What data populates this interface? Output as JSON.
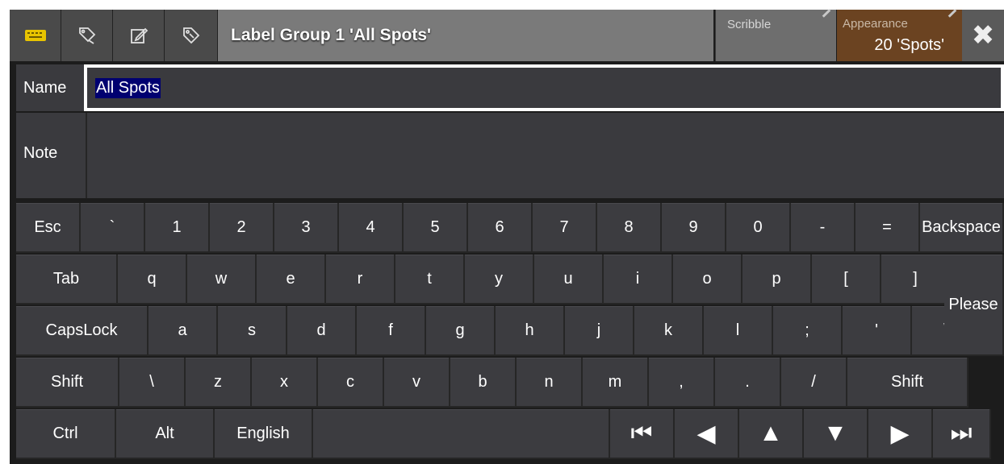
{
  "titlebar": {
    "icons": [
      {
        "name": "keyboard-icon",
        "color": "#e8c400"
      },
      {
        "name": "label-pen-icon"
      },
      {
        "name": "edit-icon"
      },
      {
        "name": "tag-icon"
      }
    ],
    "title": "Label Group 1 'All Spots'",
    "scribble_label": "Scribble",
    "appearance_label": "Appearance",
    "appearance_value": "20 'Spots'",
    "appearance_color": "#6b4321",
    "close_icon": "close-icon"
  },
  "form": {
    "name_label": "Name",
    "name_value": "All Spots",
    "note_label": "Note",
    "note_value": ""
  },
  "keyboard": {
    "rows": [
      [
        "Esc",
        "`",
        "1",
        "2",
        "3",
        "4",
        "5",
        "6",
        "7",
        "8",
        "9",
        "0",
        "-",
        "=",
        "Backspace"
      ],
      [
        "Tab",
        "q",
        "w",
        "e",
        "r",
        "t",
        "y",
        "u",
        "i",
        "o",
        "p",
        "[",
        "]"
      ],
      [
        "CapsLock",
        "a",
        "s",
        "d",
        "f",
        "g",
        "h",
        "j",
        "k",
        "l",
        ";",
        "'",
        "\\"
      ],
      [
        "Shift",
        "\\",
        "z",
        "x",
        "c",
        "v",
        "b",
        "n",
        "m",
        ",",
        ".",
        "/",
        "Shift"
      ],
      [
        "Ctrl",
        "Alt",
        "English",
        ""
      ]
    ],
    "please": "Please",
    "nav_keys": [
      {
        "name": "first-icon",
        "glyph": "⏮"
      },
      {
        "name": "left-arrow-icon",
        "glyph": "◀"
      },
      {
        "name": "up-arrow-icon",
        "glyph": "▲"
      },
      {
        "name": "down-arrow-icon",
        "glyph": "▼"
      },
      {
        "name": "right-arrow-icon",
        "glyph": "▶"
      },
      {
        "name": "last-icon",
        "glyph": "⏭"
      }
    ]
  }
}
